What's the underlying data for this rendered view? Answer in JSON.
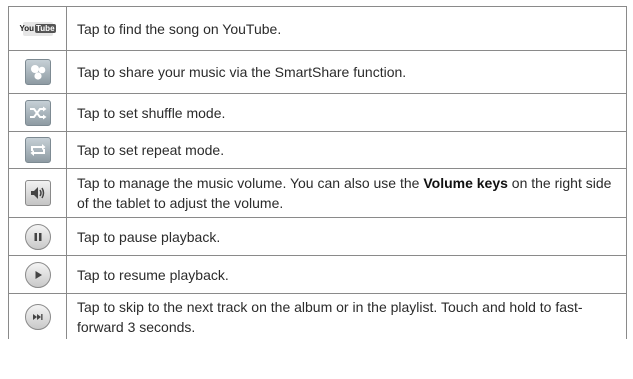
{
  "rows": [
    {
      "icon": "youtube-icon",
      "icon_text_a": "You",
      "icon_text_b": "Tube",
      "text": "Tap to find the song on YouTube."
    },
    {
      "icon": "smartshare-icon",
      "text": "Tap to share your music via the SmartShare function."
    },
    {
      "icon": "shuffle-icon",
      "text": "Tap to set shuffle mode."
    },
    {
      "icon": "repeat-icon",
      "text": "Tap to set repeat mode."
    },
    {
      "icon": "volume-icon",
      "text_a": "Tap to manage the music volume. You can also use the ",
      "text_bold": "Volume keys",
      "text_b": " on the right side of the tablet to adjust the volume."
    },
    {
      "icon": "pause-icon",
      "text": "Tap to pause playback."
    },
    {
      "icon": "play-icon",
      "text": "Tap to resume playback."
    },
    {
      "icon": "skip-next-icon",
      "text": "Tap to skip to the next track on the album or in the playlist. Touch and hold to fast-forward 3 seconds."
    }
  ]
}
